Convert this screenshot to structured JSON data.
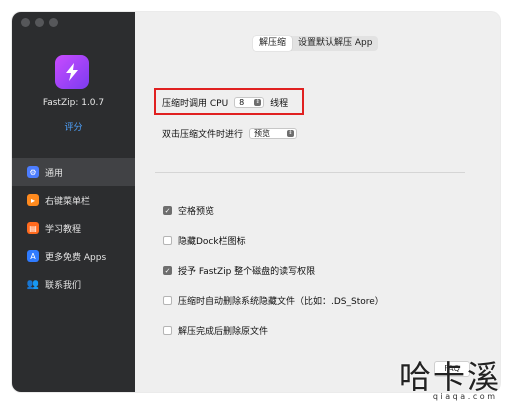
{
  "app": {
    "name": "FastZip: 1.0.7",
    "rating": "评分"
  },
  "sidebar": {
    "items": [
      {
        "label": "通用",
        "icon": "gear-icon",
        "color": "#4c7dff"
      },
      {
        "label": "右键菜单栏",
        "icon": "menu-icon",
        "color": "#ff8a1e"
      },
      {
        "label": "学习教程",
        "icon": "book-icon",
        "color": "#ff6a1e"
      },
      {
        "label": "更多免费 Apps",
        "icon": "app-store-icon",
        "color": "#2f7bff"
      },
      {
        "label": "联系我们",
        "icon": "contacts-icon",
        "color": "#5a5a5a"
      }
    ]
  },
  "tabs": [
    {
      "label": "解压缩",
      "active": true
    },
    {
      "label": "设置默认解压 App",
      "active": false
    }
  ],
  "settings": {
    "cpu_label": "压缩时调用 CPU",
    "cpu_value": "8",
    "cpu_suffix": "线程",
    "dblclick_label": "双击压缩文件时进行",
    "dblclick_value": "预览"
  },
  "options": [
    {
      "label": "空格预览",
      "checked": true
    },
    {
      "label": "隐藏Dock栏图标",
      "checked": false
    },
    {
      "label": "授予 FastZip 整个磁盘的读写权限",
      "checked": true
    },
    {
      "label": "压缩时自动删除系统隐藏文件（比如：.DS_Store）",
      "checked": false
    },
    {
      "label": "解压完成后删除原文件",
      "checked": false
    }
  ],
  "faq": "FAQ",
  "watermark": {
    "text": "哈卡溪",
    "url": "q i a q a . c o m"
  }
}
